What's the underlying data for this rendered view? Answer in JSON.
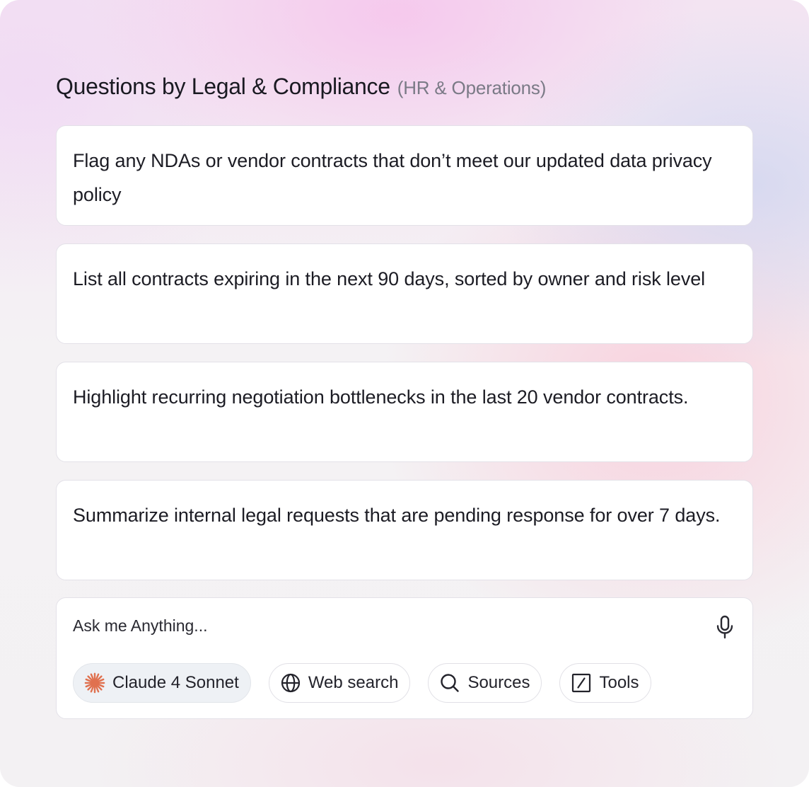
{
  "header": {
    "title": "Questions by Legal & Compliance",
    "subtitle": "(HR & Operations)"
  },
  "questions": [
    {
      "text": "Flag any NDAs or vendor contracts that don’t meet our updated data privacy policy"
    },
    {
      "text": "List all contracts expiring in the next 90 days, sorted by owner and risk level"
    },
    {
      "text": "Highlight recurring negotiation bottlenecks in the last 20 vendor contracts."
    },
    {
      "text": "Summarize internal legal requests that are pending response for over 7 days."
    }
  ],
  "composer": {
    "placeholder": "Ask me Anything...",
    "mic_icon": "microphone-icon",
    "chips": [
      {
        "label": "Claude 4 Sonnet",
        "icon": "claude-starburst-icon",
        "color": "#e0714f",
        "selected": true
      },
      {
        "label": "Web search",
        "icon": "globe-icon",
        "selected": false
      },
      {
        "label": "Sources",
        "icon": "search-icon",
        "selected": false
      },
      {
        "label": "Tools",
        "icon": "tools-icon",
        "selected": false
      }
    ]
  },
  "colors": {
    "accent": "#e0714f",
    "text": "#1c1c24",
    "muted": "#7a7a86"
  }
}
